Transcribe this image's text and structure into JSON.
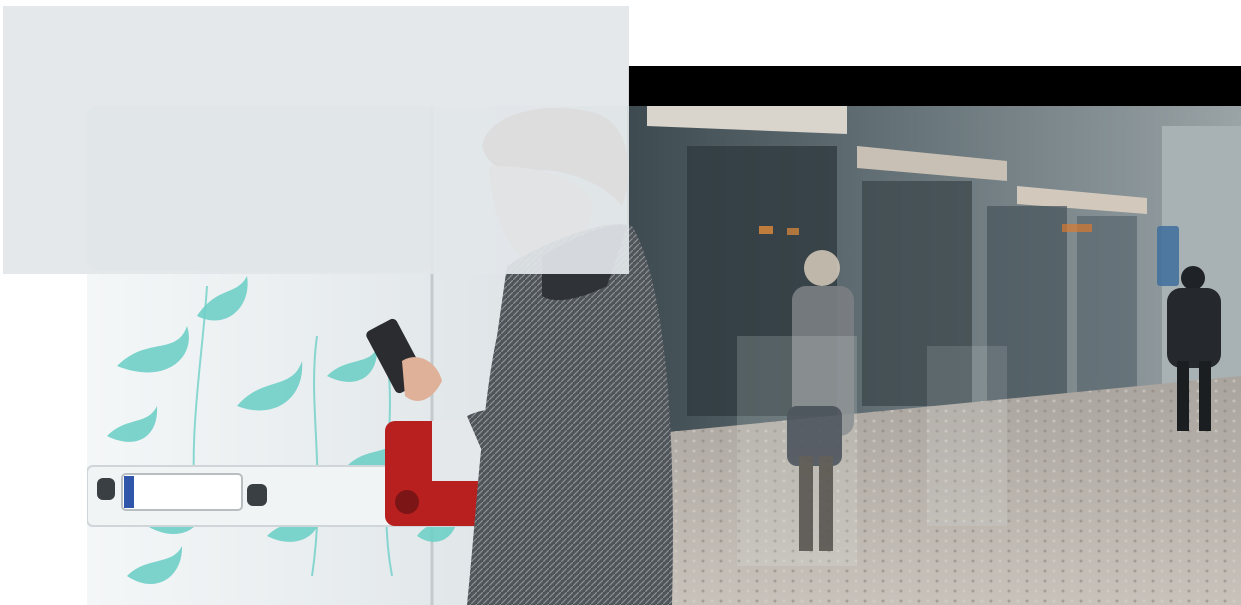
{
  "photo": {
    "subject": "woman-reading-phone-on-street",
    "palette": {
      "van": "#e9eef0",
      "floral": "#6fd0c8",
      "coat": "#4a4e52",
      "hair": "#9a6a48",
      "tram": "#5e6a70",
      "pavement": "#b9b4ae",
      "taillight": "#b82020"
    }
  },
  "overlay": {
    "panel_color": "#e2e6ea",
    "band_color": "#000000"
  }
}
